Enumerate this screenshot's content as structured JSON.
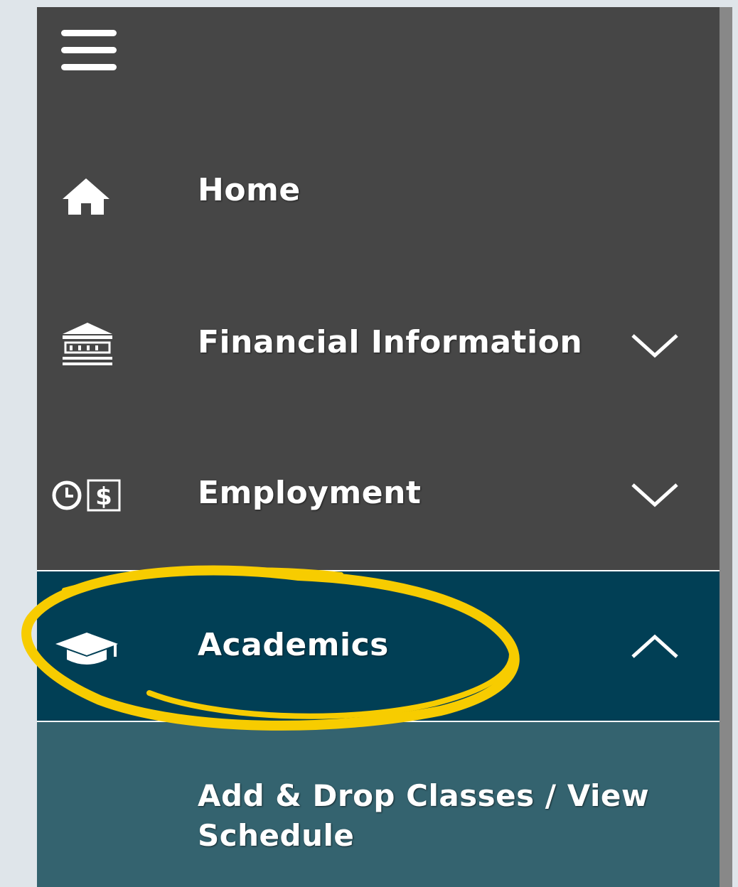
{
  "nav": {
    "items": [
      {
        "label": "Home",
        "icon": "home-icon"
      },
      {
        "label": "Financial Information",
        "icon": "bank-icon",
        "state": "collapsed"
      },
      {
        "label": "Employment",
        "icon": "clock-dollar-icon",
        "state": "collapsed"
      },
      {
        "label": "Academics",
        "icon": "graduation-cap-icon",
        "state": "expanded"
      }
    ],
    "subitems": [
      {
        "label": "Add & Drop Classes / View Schedule"
      }
    ]
  },
  "colors": {
    "sidebar_bg": "#464646",
    "active_bg": "#013f55",
    "submenu_bg": "#34636f",
    "highlight": "#f7cc00",
    "page_bg": "#dfe5ea"
  }
}
